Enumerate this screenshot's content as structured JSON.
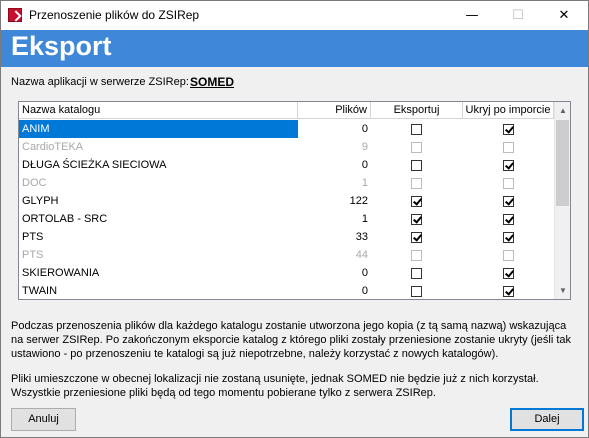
{
  "window": {
    "title": "Przenoszenie plików do ZSIRep",
    "minimize": "—",
    "maximize": "☐",
    "close": "✕"
  },
  "header": {
    "title": "Eksport"
  },
  "app_info": {
    "label": "Nazwa aplikacji w serwerze ZSIRep:",
    "value": "SOMED"
  },
  "table": {
    "columns": [
      "Nazwa katalogu",
      "Plików",
      "Eksportuj",
      "Ukryj po imporcie"
    ],
    "rows": [
      {
        "name": "ANIM",
        "count": "0",
        "export": false,
        "hide": true,
        "disabled": false,
        "selected": true
      },
      {
        "name": "CardioTEKA",
        "count": "9",
        "export": false,
        "hide": false,
        "disabled": true,
        "selected": false
      },
      {
        "name": "DŁUGA ŚCIEŻKA SIECIOWA",
        "count": "0",
        "export": false,
        "hide": true,
        "disabled": false,
        "selected": false
      },
      {
        "name": "DOC",
        "count": "1",
        "export": false,
        "hide": false,
        "disabled": true,
        "selected": false
      },
      {
        "name": "GLYPH",
        "count": "122",
        "export": true,
        "hide": true,
        "disabled": false,
        "selected": false
      },
      {
        "name": "ORTOLAB - SRC",
        "count": "1",
        "export": true,
        "hide": true,
        "disabled": false,
        "selected": false
      },
      {
        "name": "PTS",
        "count": "33",
        "export": true,
        "hide": true,
        "disabled": false,
        "selected": false
      },
      {
        "name": "PTS",
        "count": "44",
        "export": false,
        "hide": false,
        "disabled": true,
        "selected": false
      },
      {
        "name": "SKIEROWANIA",
        "count": "0",
        "export": false,
        "hide": true,
        "disabled": false,
        "selected": false
      },
      {
        "name": "TWAIN",
        "count": "0",
        "export": false,
        "hide": true,
        "disabled": false,
        "selected": false
      }
    ]
  },
  "info": {
    "paragraph1": "Podczas przenoszenia plików dla każdego katalogu zostanie utworzona jego kopia (z tą samą nazwą) wskazująca na serwer ZSIRep. Po zakończonym eksporcie katalog z którego pliki zostały przeniesione zostanie ukryty (jeśli tak ustawiono - po przenoszeniu te katalogi są już niepotrzebne, należy korzystać z nowych katalogów).",
    "paragraph2": "Pliki umieszczone w obecnej lokalizacji nie zostaną usunięte, jednak SOMED nie będzie już z nich korzystał. Wszystkie przeniesione pliki będą od tego momentu pobierane tylko z serwera ZSIRep."
  },
  "buttons": {
    "cancel": "Anuluj",
    "next": "Dalej"
  },
  "colors": {
    "header_band": "#3f87d9",
    "selection": "#0078d7"
  }
}
